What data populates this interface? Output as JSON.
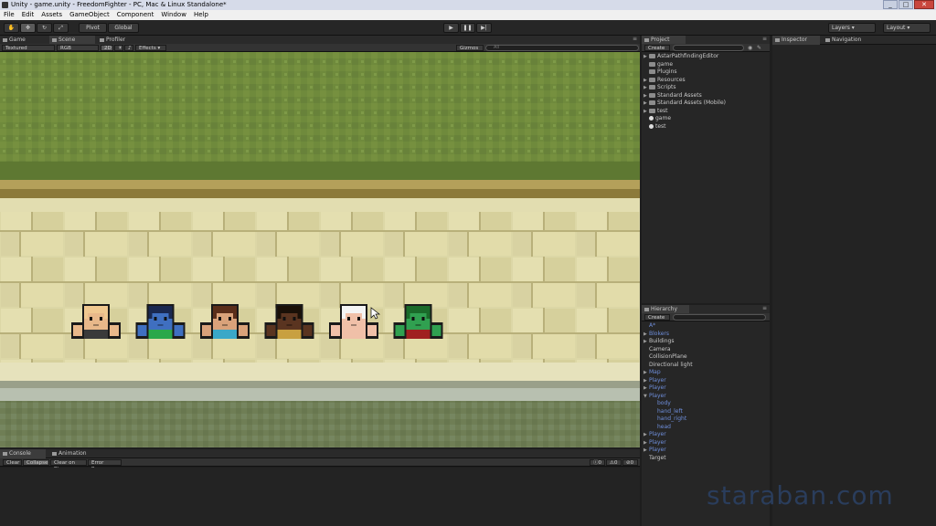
{
  "window": {
    "title": "Unity - game.unity - FreedomFighter - PC, Mac & Linux Standalone*"
  },
  "menu": [
    "File",
    "Edit",
    "Assets",
    "GameObject",
    "Component",
    "Window",
    "Help"
  ],
  "toolbar": {
    "pivot": "Pivot",
    "global": "Global",
    "layers": "Layers",
    "layout": "Layout"
  },
  "scene_panel": {
    "tabs": [
      "Game",
      "Scene",
      "Profiler"
    ],
    "render_mode": "Textured",
    "color_mode": "RGB",
    "mode_2d": "2D",
    "effects": "Effects",
    "gizmos": "Gizmos",
    "search_placeholder": "All"
  },
  "project": {
    "tab": "Project",
    "create": "Create",
    "items": [
      {
        "label": "AstarPathfindingEditor",
        "indent": 0,
        "arrow": true,
        "icon": "folder"
      },
      {
        "label": "game",
        "indent": 0,
        "arrow": false,
        "icon": "folder"
      },
      {
        "label": "Plugins",
        "indent": 0,
        "arrow": false,
        "icon": "folder"
      },
      {
        "label": "Resources",
        "indent": 0,
        "arrow": true,
        "icon": "folder"
      },
      {
        "label": "Scripts",
        "indent": 0,
        "arrow": true,
        "icon": "folder"
      },
      {
        "label": "Standard Assets",
        "indent": 0,
        "arrow": true,
        "icon": "folder"
      },
      {
        "label": "Standard Assets (Mobile)",
        "indent": 0,
        "arrow": true,
        "icon": "folder"
      },
      {
        "label": "test",
        "indent": 0,
        "arrow": true,
        "icon": "folder"
      },
      {
        "label": "game",
        "indent": 0,
        "arrow": false,
        "icon": "unity"
      },
      {
        "label": "test",
        "indent": 0,
        "arrow": false,
        "icon": "unity"
      }
    ]
  },
  "inspector": {
    "tabs": [
      "Inspector",
      "Navigation"
    ]
  },
  "hierarchy": {
    "tab": "Hierarchy",
    "create": "Create",
    "items": [
      {
        "label": "A*",
        "indent": 0,
        "arrow": false,
        "blue": true
      },
      {
        "label": "Blokers",
        "indent": 0,
        "arrow": true,
        "blue": true
      },
      {
        "label": "Buildings",
        "indent": 0,
        "arrow": true,
        "blue": false
      },
      {
        "label": "Camera",
        "indent": 0,
        "arrow": false,
        "blue": false
      },
      {
        "label": "CollisionPlane",
        "indent": 0,
        "arrow": false,
        "blue": false
      },
      {
        "label": "Directional light",
        "indent": 0,
        "arrow": false,
        "blue": false
      },
      {
        "label": "Map",
        "indent": 0,
        "arrow": true,
        "blue": true
      },
      {
        "label": "Player",
        "indent": 0,
        "arrow": true,
        "blue": true
      },
      {
        "label": "Player",
        "indent": 0,
        "arrow": true,
        "blue": true
      },
      {
        "label": "Player",
        "indent": 0,
        "arrow": "open",
        "blue": true
      },
      {
        "label": "body",
        "indent": 1,
        "arrow": false,
        "blue": true
      },
      {
        "label": "hand_left",
        "indent": 1,
        "arrow": false,
        "blue": true
      },
      {
        "label": "hand_right",
        "indent": 1,
        "arrow": false,
        "blue": true
      },
      {
        "label": "head",
        "indent": 1,
        "arrow": false,
        "blue": true
      },
      {
        "label": "Player",
        "indent": 0,
        "arrow": true,
        "blue": true
      },
      {
        "label": "Player",
        "indent": 0,
        "arrow": true,
        "blue": true
      },
      {
        "label": "Player",
        "indent": 0,
        "arrow": true,
        "blue": true
      },
      {
        "label": "Target",
        "indent": 0,
        "arrow": false,
        "blue": false
      }
    ]
  },
  "console": {
    "tabs": [
      "Console",
      "Animation"
    ],
    "buttons": [
      "Clear",
      "Collapse",
      "Clear on Play",
      "Error Pause"
    ],
    "counts": {
      "logs": "0",
      "warnings": "0",
      "errors": "0"
    }
  },
  "characters": [
    {
      "name": "bald",
      "skin": "#e8b88a",
      "hair": "#f0c890",
      "shirt": "#3a3a3a"
    },
    {
      "name": "blue",
      "skin": "#3f6fc0",
      "hair": "#1a2850",
      "shirt": "#2aa84a"
    },
    {
      "name": "brown-hair",
      "skin": "#d9a27a",
      "hair": "#5a2e1a",
      "shirt": "#3aa8c8"
    },
    {
      "name": "dark",
      "skin": "#5a3420",
      "hair": "#1a1008",
      "shirt": "#c8a040"
    },
    {
      "name": "white-hair",
      "skin": "#f0c0a8",
      "hair": "#f4f4f4",
      "shirt": "#f0c0a8"
    },
    {
      "name": "green",
      "skin": "#30a050",
      "hair": "#1a6a2a",
      "shirt": "#a02020"
    }
  ],
  "watermark": "staraban.com"
}
